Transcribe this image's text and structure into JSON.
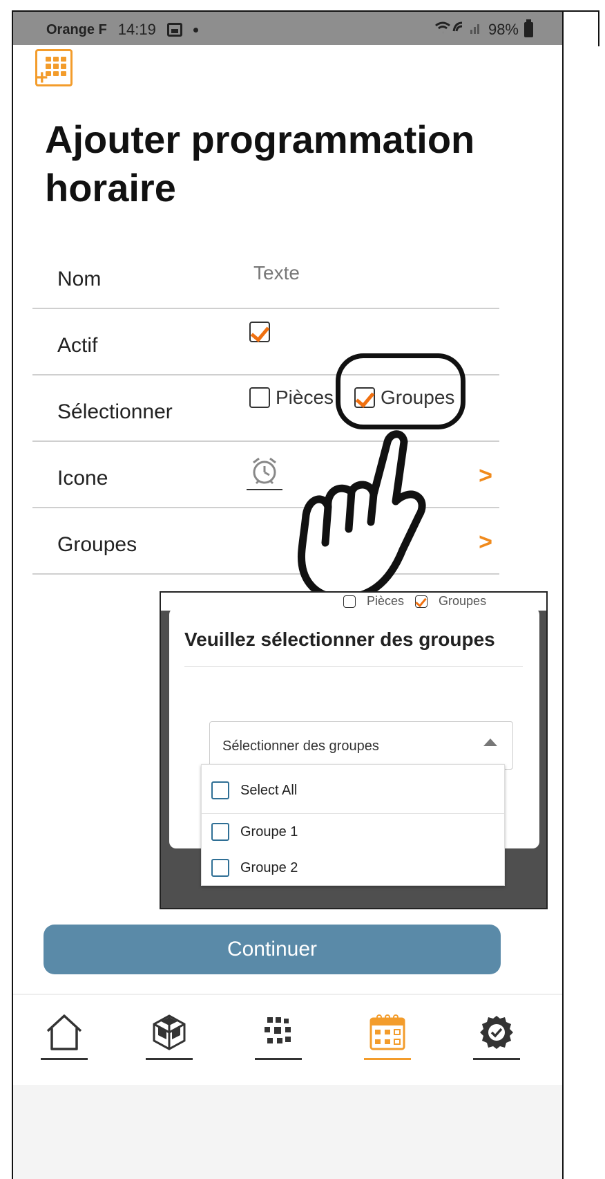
{
  "status_bar": {
    "carrier": "Orange F",
    "time": "14:19",
    "battery": "98%"
  },
  "page": {
    "title": "Ajouter programmation horaire"
  },
  "form": {
    "name_label": "Nom",
    "name_placeholder": "Texte",
    "active_label": "Actif",
    "active_checked": true,
    "select_label": "Sélectionner",
    "option_rooms": "Pièces",
    "option_rooms_checked": false,
    "option_groups": "Groupes",
    "option_groups_checked": true,
    "icon_label": "Icone",
    "icon_name": "alarm-clock-icon",
    "groups_label": "Groupes"
  },
  "dialog": {
    "header_rooms": "Pièces",
    "header_groups": "Groupes",
    "title": "Veuillez sélectionner des groupes",
    "dropdown_placeholder": "Sélectionner des groupes",
    "items": [
      {
        "label": "Select All",
        "checked": false
      },
      {
        "label": "Groupe 1",
        "checked": false
      },
      {
        "label": "Groupe 2",
        "checked": false
      }
    ]
  },
  "actions": {
    "continue_label": "Continuer"
  },
  "bottom_nav": [
    {
      "icon": "home-icon",
      "active": false
    },
    {
      "icon": "cube-icon",
      "active": false
    },
    {
      "icon": "scenes-icon",
      "active": false
    },
    {
      "icon": "calendar-icon",
      "active": true
    },
    {
      "icon": "gear-icon",
      "active": false
    }
  ],
  "colors": {
    "accent": "#f39c2b",
    "check": "#f07010",
    "button": "#5a8aa8",
    "checkbox_border": "#2f6f95"
  }
}
